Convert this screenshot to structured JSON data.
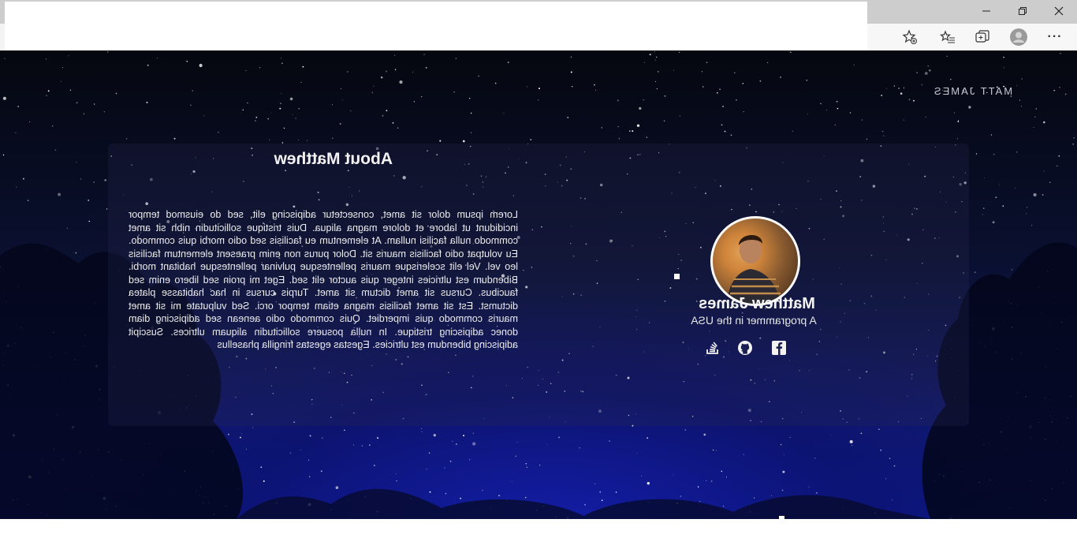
{
  "browser": {
    "window_controls": {
      "minimize": "—",
      "restore": "❐",
      "close": "✕"
    },
    "toolbar_icons": [
      "add-favorite-icon",
      "favorites-icon",
      "collections-icon",
      "profile-icon",
      "more-icon"
    ],
    "more_label": "···"
  },
  "site": {
    "brand": "MATT JAMES"
  },
  "about": {
    "title": "About Matthew",
    "text": "Lorem ipsum dolor sit amet, consectetur adipiscing elit, sed do eiusmod tempor incididunt ut labore et dolore magna aliqua. Duis tristique sollicitudin nibh sit amet commodo nulla facilisi nullam. At elementum eu facilisis sed odio morbi quis commodo. Eu volutpat odio facilisis mauris sit. Dolor purus non enim praesent elementum facilisis leo vel. Vel elit scelerisque mauris pellentesque pulvinar pellentesque habitant morbi. Bibendum est ultricies integer quis auctor elit sed. Eget mi proin sed libero enim sed faucibus. Cursus sit amet dictum sit amet. Turpis cursus in hac habitasse platea dictumst. Est sit amet facilisis magna etiam tempor orci. Sed vulputate mi sit amet mauris commodo quis imperdiet. Quis commodo odio aenean sed adipiscing diam donec adipiscing tristique. In nulla posuere sollicitudin aliquam ultrices. Suscipit adipiscing bibendum est ultricies. Egestas egestas fringilla phasellus"
  },
  "profile": {
    "name": "Matthew James",
    "subtitle": "A programmer in the USA",
    "social_icons": [
      "stackoverflow-icon",
      "github-icon",
      "facebook-icon"
    ]
  },
  "colors": {
    "page_bg_top": "#05070f",
    "page_bg_bottom": "#0e1a86",
    "text": "#f2f2f2"
  }
}
